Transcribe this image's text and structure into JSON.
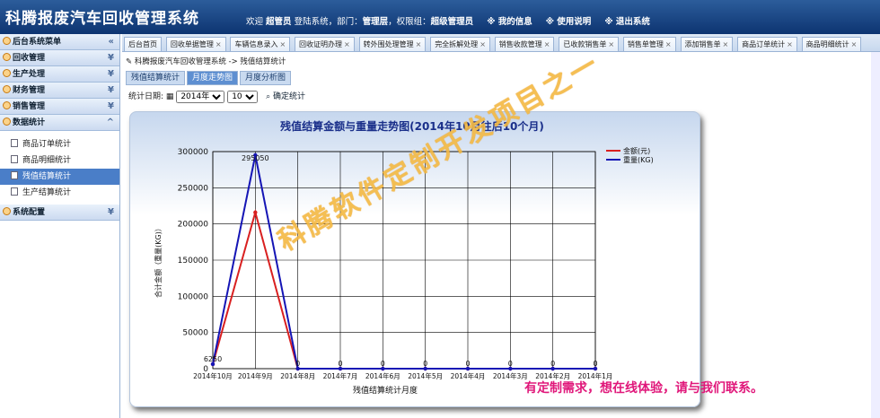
{
  "header": {
    "title": "科腾报废汽车回收管理系统",
    "welcome_prefix": "欢迎",
    "username": "超管员",
    "welcome_mid": "登陆系统，部门：",
    "department": "管理层",
    "perm_prefix": "，权限组：",
    "perm_group": "超级管理员",
    "links": [
      "※ 我的信息",
      "※ 使用说明",
      "※ 退出系统"
    ]
  },
  "sidebar": {
    "title": "后台系统菜单",
    "sections": [
      "回收管理",
      "生产处理",
      "财务管理",
      "销售管理",
      "数据统计"
    ],
    "items": [
      "商品订单统计",
      "商品明细统计",
      "残值结算统计",
      "生产结算统计"
    ],
    "config": "系统配置"
  },
  "tabs": [
    "后台首页",
    "回收单据管理",
    "车辆信息录入",
    "回收证明办理",
    "转外围处理管理",
    "完全拆解处理",
    "销售收款管理",
    "已收款销售单",
    "销售单管理",
    "添加销售单",
    "商品订单统计",
    "商品明细统计"
  ],
  "breadcrumb": "科腾报废汽车回收管理系统 -> 残值结算统计",
  "subtabs": [
    "残值结算统计",
    "月度走势图",
    "月度分析图"
  ],
  "filter": {
    "label": "统计日期:",
    "year": "2014年",
    "month": "10",
    "confirm": "确定统计"
  },
  "chart_data": {
    "type": "line",
    "title": "残值结算金额与重量走势图(2014年10月往后10个月)",
    "xlabel": "残值结算统计月度",
    "ylabel": "合计金额（重量(KG)）",
    "categories": [
      "2014年10月",
      "2014年9月",
      "2014年8月",
      "2014年7月",
      "2014年6月",
      "2014年5月",
      "2014年4月",
      "2014年3月",
      "2014年2月",
      "2014年1月"
    ],
    "ylim": [
      0,
      300000
    ],
    "yticks": [
      0,
      50000,
      100000,
      150000,
      200000,
      250000,
      300000
    ],
    "series": [
      {
        "name": "金额(元)",
        "color": "#d92020",
        "values": [
          6250,
          216000,
          0,
          0,
          0,
          0,
          0,
          0,
          0,
          0
        ]
      },
      {
        "name": "重量(KG)",
        "color": "#1515b5",
        "values": [
          6250,
          295050,
          0,
          0,
          0,
          0,
          0,
          0,
          0,
          0
        ]
      }
    ],
    "point_labels": [
      "6250",
      "295050",
      "0",
      "0",
      "0",
      "0",
      "0",
      "0",
      "0",
      "0"
    ],
    "legend": "top-right",
    "grid": true
  },
  "watermark": "科腾软件定制开发项目之一",
  "promo": "有定制需求，想在线体验，请与我们联系。"
}
